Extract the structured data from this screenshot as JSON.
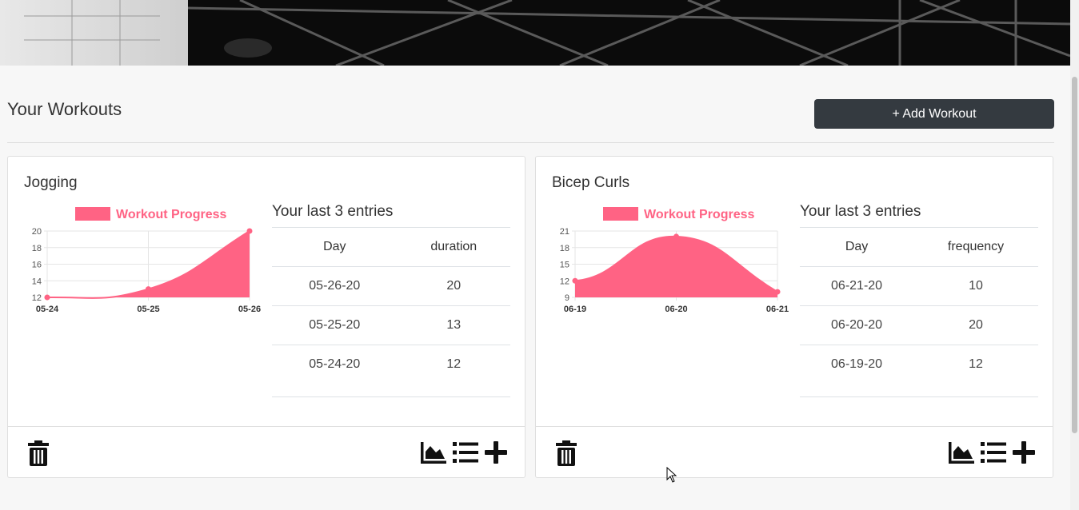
{
  "header": {
    "title": "Your Workouts",
    "add_button_label": "+ Add Workout"
  },
  "workouts": [
    {
      "name": "Jogging",
      "entries_title": "Your last 3 entries",
      "columns": [
        "Day",
        "duration"
      ],
      "rows": [
        [
          "05-26-20",
          "20"
        ],
        [
          "05-25-20",
          "13"
        ],
        [
          "05-24-20",
          "12"
        ]
      ],
      "icons": [
        "trash-icon",
        "chart-area-icon",
        "list-icon",
        "plus-icon"
      ]
    },
    {
      "name": "Bicep Curls",
      "entries_title": "Your last 3 entries",
      "columns": [
        "Day",
        "frequency"
      ],
      "rows": [
        [
          "06-21-20",
          "10"
        ],
        [
          "06-20-20",
          "20"
        ],
        [
          "06-19-20",
          "12"
        ]
      ],
      "icons": [
        "trash-icon",
        "chart-area-icon",
        "list-icon",
        "plus-icon"
      ]
    }
  ],
  "chart_data": [
    {
      "type": "area",
      "legend": "Workout Progress",
      "color": "#ff6384",
      "x": [
        "05-24",
        "05-25",
        "05-26"
      ],
      "y": [
        12,
        13,
        20
      ],
      "ylim": [
        12,
        20
      ],
      "yticks": [
        12,
        14,
        16,
        18,
        20
      ],
      "grid": true,
      "legend_position": "top"
    },
    {
      "type": "area",
      "legend": "Workout Progress",
      "color": "#ff6384",
      "x": [
        "06-19",
        "06-20",
        "06-21"
      ],
      "y": [
        12,
        20,
        10
      ],
      "ylim": [
        9,
        21
      ],
      "yticks": [
        9,
        12,
        15,
        18,
        21
      ],
      "grid": true,
      "legend_position": "top"
    }
  ]
}
